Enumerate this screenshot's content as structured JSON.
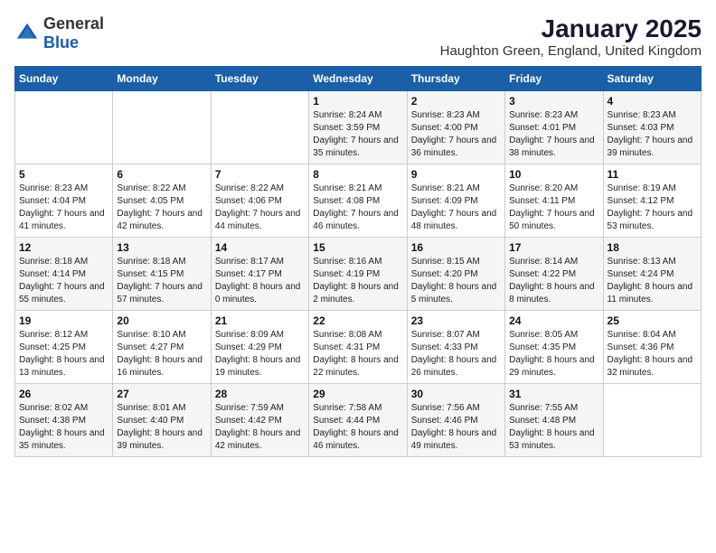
{
  "logo": {
    "general": "General",
    "blue": "Blue"
  },
  "title": "January 2025",
  "subtitle": "Haughton Green, England, United Kingdom",
  "days_of_week": [
    "Sunday",
    "Monday",
    "Tuesday",
    "Wednesday",
    "Thursday",
    "Friday",
    "Saturday"
  ],
  "weeks": [
    [
      {
        "day": "",
        "sunrise": "",
        "sunset": "",
        "daylight": ""
      },
      {
        "day": "",
        "sunrise": "",
        "sunset": "",
        "daylight": ""
      },
      {
        "day": "",
        "sunrise": "",
        "sunset": "",
        "daylight": ""
      },
      {
        "day": "1",
        "sunrise": "Sunrise: 8:24 AM",
        "sunset": "Sunset: 3:59 PM",
        "daylight": "Daylight: 7 hours and 35 minutes."
      },
      {
        "day": "2",
        "sunrise": "Sunrise: 8:23 AM",
        "sunset": "Sunset: 4:00 PM",
        "daylight": "Daylight: 7 hours and 36 minutes."
      },
      {
        "day": "3",
        "sunrise": "Sunrise: 8:23 AM",
        "sunset": "Sunset: 4:01 PM",
        "daylight": "Daylight: 7 hours and 38 minutes."
      },
      {
        "day": "4",
        "sunrise": "Sunrise: 8:23 AM",
        "sunset": "Sunset: 4:03 PM",
        "daylight": "Daylight: 7 hours and 39 minutes."
      }
    ],
    [
      {
        "day": "5",
        "sunrise": "Sunrise: 8:23 AM",
        "sunset": "Sunset: 4:04 PM",
        "daylight": "Daylight: 7 hours and 41 minutes."
      },
      {
        "day": "6",
        "sunrise": "Sunrise: 8:22 AM",
        "sunset": "Sunset: 4:05 PM",
        "daylight": "Daylight: 7 hours and 42 minutes."
      },
      {
        "day": "7",
        "sunrise": "Sunrise: 8:22 AM",
        "sunset": "Sunset: 4:06 PM",
        "daylight": "Daylight: 7 hours and 44 minutes."
      },
      {
        "day": "8",
        "sunrise": "Sunrise: 8:21 AM",
        "sunset": "Sunset: 4:08 PM",
        "daylight": "Daylight: 7 hours and 46 minutes."
      },
      {
        "day": "9",
        "sunrise": "Sunrise: 8:21 AM",
        "sunset": "Sunset: 4:09 PM",
        "daylight": "Daylight: 7 hours and 48 minutes."
      },
      {
        "day": "10",
        "sunrise": "Sunrise: 8:20 AM",
        "sunset": "Sunset: 4:11 PM",
        "daylight": "Daylight: 7 hours and 50 minutes."
      },
      {
        "day": "11",
        "sunrise": "Sunrise: 8:19 AM",
        "sunset": "Sunset: 4:12 PM",
        "daylight": "Daylight: 7 hours and 53 minutes."
      }
    ],
    [
      {
        "day": "12",
        "sunrise": "Sunrise: 8:18 AM",
        "sunset": "Sunset: 4:14 PM",
        "daylight": "Daylight: 7 hours and 55 minutes."
      },
      {
        "day": "13",
        "sunrise": "Sunrise: 8:18 AM",
        "sunset": "Sunset: 4:15 PM",
        "daylight": "Daylight: 7 hours and 57 minutes."
      },
      {
        "day": "14",
        "sunrise": "Sunrise: 8:17 AM",
        "sunset": "Sunset: 4:17 PM",
        "daylight": "Daylight: 8 hours and 0 minutes."
      },
      {
        "day": "15",
        "sunrise": "Sunrise: 8:16 AM",
        "sunset": "Sunset: 4:19 PM",
        "daylight": "Daylight: 8 hours and 2 minutes."
      },
      {
        "day": "16",
        "sunrise": "Sunrise: 8:15 AM",
        "sunset": "Sunset: 4:20 PM",
        "daylight": "Daylight: 8 hours and 5 minutes."
      },
      {
        "day": "17",
        "sunrise": "Sunrise: 8:14 AM",
        "sunset": "Sunset: 4:22 PM",
        "daylight": "Daylight: 8 hours and 8 minutes."
      },
      {
        "day": "18",
        "sunrise": "Sunrise: 8:13 AM",
        "sunset": "Sunset: 4:24 PM",
        "daylight": "Daylight: 8 hours and 11 minutes."
      }
    ],
    [
      {
        "day": "19",
        "sunrise": "Sunrise: 8:12 AM",
        "sunset": "Sunset: 4:25 PM",
        "daylight": "Daylight: 8 hours and 13 minutes."
      },
      {
        "day": "20",
        "sunrise": "Sunrise: 8:10 AM",
        "sunset": "Sunset: 4:27 PM",
        "daylight": "Daylight: 8 hours and 16 minutes."
      },
      {
        "day": "21",
        "sunrise": "Sunrise: 8:09 AM",
        "sunset": "Sunset: 4:29 PM",
        "daylight": "Daylight: 8 hours and 19 minutes."
      },
      {
        "day": "22",
        "sunrise": "Sunrise: 8:08 AM",
        "sunset": "Sunset: 4:31 PM",
        "daylight": "Daylight: 8 hours and 22 minutes."
      },
      {
        "day": "23",
        "sunrise": "Sunrise: 8:07 AM",
        "sunset": "Sunset: 4:33 PM",
        "daylight": "Daylight: 8 hours and 26 minutes."
      },
      {
        "day": "24",
        "sunrise": "Sunrise: 8:05 AM",
        "sunset": "Sunset: 4:35 PM",
        "daylight": "Daylight: 8 hours and 29 minutes."
      },
      {
        "day": "25",
        "sunrise": "Sunrise: 8:04 AM",
        "sunset": "Sunset: 4:36 PM",
        "daylight": "Daylight: 8 hours and 32 minutes."
      }
    ],
    [
      {
        "day": "26",
        "sunrise": "Sunrise: 8:02 AM",
        "sunset": "Sunset: 4:38 PM",
        "daylight": "Daylight: 8 hours and 35 minutes."
      },
      {
        "day": "27",
        "sunrise": "Sunrise: 8:01 AM",
        "sunset": "Sunset: 4:40 PM",
        "daylight": "Daylight: 8 hours and 39 minutes."
      },
      {
        "day": "28",
        "sunrise": "Sunrise: 7:59 AM",
        "sunset": "Sunset: 4:42 PM",
        "daylight": "Daylight: 8 hours and 42 minutes."
      },
      {
        "day": "29",
        "sunrise": "Sunrise: 7:58 AM",
        "sunset": "Sunset: 4:44 PM",
        "daylight": "Daylight: 8 hours and 46 minutes."
      },
      {
        "day": "30",
        "sunrise": "Sunrise: 7:56 AM",
        "sunset": "Sunset: 4:46 PM",
        "daylight": "Daylight: 8 hours and 49 minutes."
      },
      {
        "day": "31",
        "sunrise": "Sunrise: 7:55 AM",
        "sunset": "Sunset: 4:48 PM",
        "daylight": "Daylight: 8 hours and 53 minutes."
      },
      {
        "day": "",
        "sunrise": "",
        "sunset": "",
        "daylight": ""
      }
    ]
  ]
}
